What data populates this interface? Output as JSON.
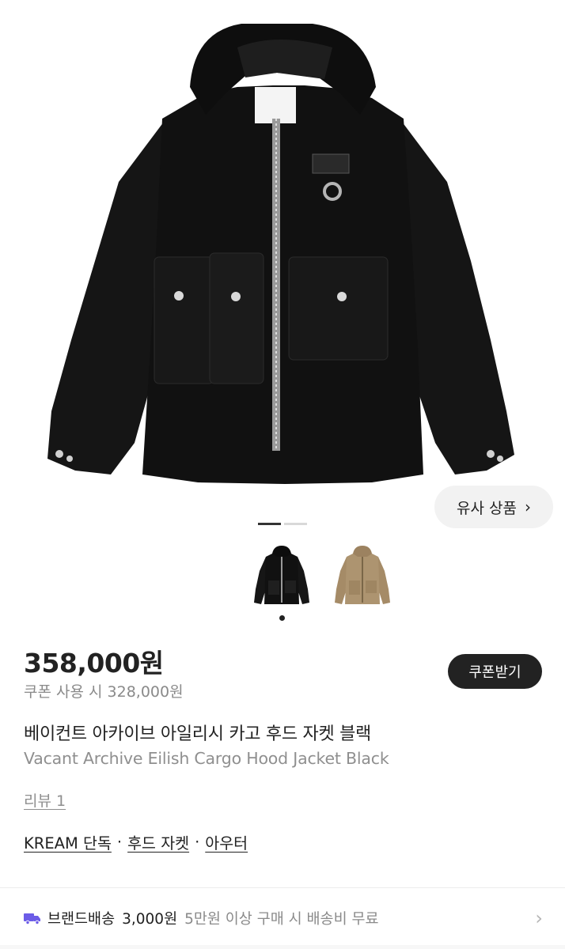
{
  "similar_products": {
    "label": "유사 상품",
    "chevron": "›"
  },
  "gallery": {
    "slides_total": 2,
    "active_slide": 1
  },
  "variants": [
    {
      "color": "#1a1a1a",
      "selected": true
    },
    {
      "color": "#a88e6a",
      "selected": false
    }
  ],
  "product": {
    "price": "358,000원",
    "coupon_price": "쿠폰 사용 시 328,000원",
    "coupon_button": "쿠폰받기",
    "name_ko": "베이컨트 아카이브 아일리시 카고 후드 자켓 블랙",
    "name_en": "Vacant Archive Eilish Cargo Hood Jacket Black",
    "review": "리뷰 1"
  },
  "tags": [
    "KREAM 단독",
    "후드 자켓",
    "아우터"
  ],
  "tag_separator": "·",
  "shipping": {
    "icon": "truck-icon",
    "label": "브랜드배송",
    "fee": "3,000원",
    "note": "5만원 이상 구매 시 배송비 무료",
    "chevron": "›"
  },
  "colors": {
    "accent": "#222222",
    "truck": "#6c5ce7",
    "muted": "#8a8a8a"
  }
}
